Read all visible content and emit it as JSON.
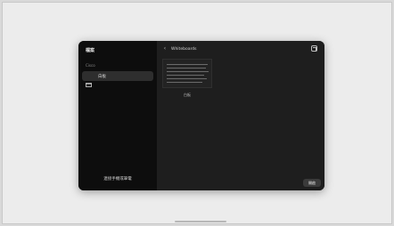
{
  "sidebar": {
    "title": "檔案",
    "section_label": "Cisco",
    "items": [
      {
        "label": "白板",
        "icon": "folder-icon"
      }
    ],
    "footer_link": "連接手機或筆電"
  },
  "main": {
    "title": "Whiteboards",
    "back_icon": "chevron-left-icon",
    "action_icon": "open-external-icon",
    "thumbnail_caption": "白板",
    "primary_button": "開啟"
  }
}
